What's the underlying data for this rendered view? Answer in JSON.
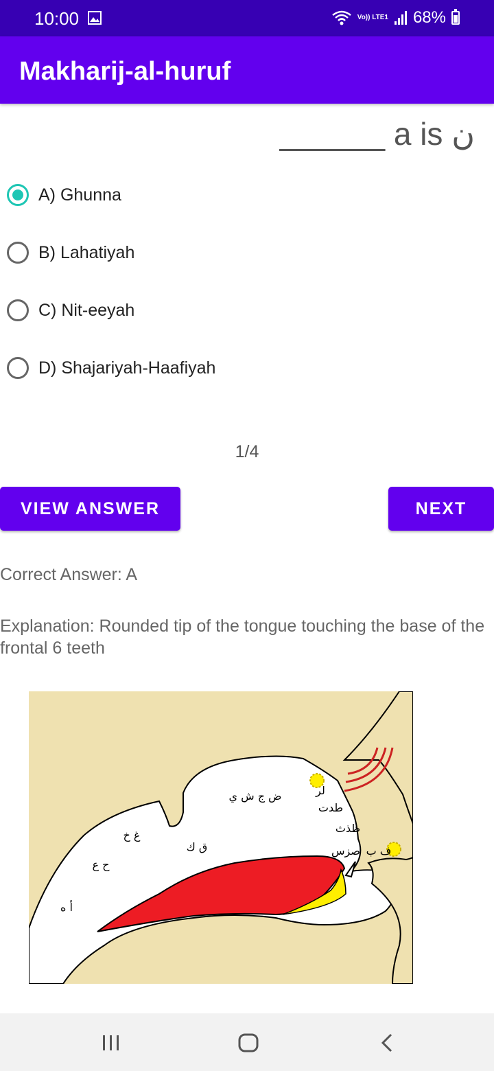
{
  "status": {
    "time": "10:00",
    "network": "Vo)) LTE1",
    "battery": "68%"
  },
  "app": {
    "title": "Makharij-al-huruf"
  },
  "question": {
    "text": "______ a is ن"
  },
  "options": [
    {
      "label": "A) Ghunna",
      "selected": true
    },
    {
      "label": "B) Lahatiyah",
      "selected": false
    },
    {
      "label": "C) Nit-eeyah",
      "selected": false
    },
    {
      "label": "D) Shajariyah-Haafiyah",
      "selected": false
    }
  ],
  "progress": {
    "text": "1/4"
  },
  "buttons": {
    "view_answer": "VIEW ANSWER",
    "next": "NEXT"
  },
  "answer": {
    "correct": "Correct Answer: A",
    "explanation": "Explanation: Rounded tip of the tongue touching the base of the frontal 6 teeth"
  },
  "diagram_labels": {
    "palate": "ض ج ش ي",
    "lr": "لر",
    "tdt": "طدت",
    "zdhth": "ظذث",
    "sz": "صزس",
    "fb": "ف ب",
    "kq": "ق ك",
    "ghkh": "غ خ",
    "ha": "ح ع",
    "hamza": "أ ه"
  },
  "colors": {
    "primary": "#6200ee",
    "status": "#3700b3",
    "accent": "#1ec6b4",
    "tongue": "#ed1c24",
    "skin": "#efe1b0"
  }
}
